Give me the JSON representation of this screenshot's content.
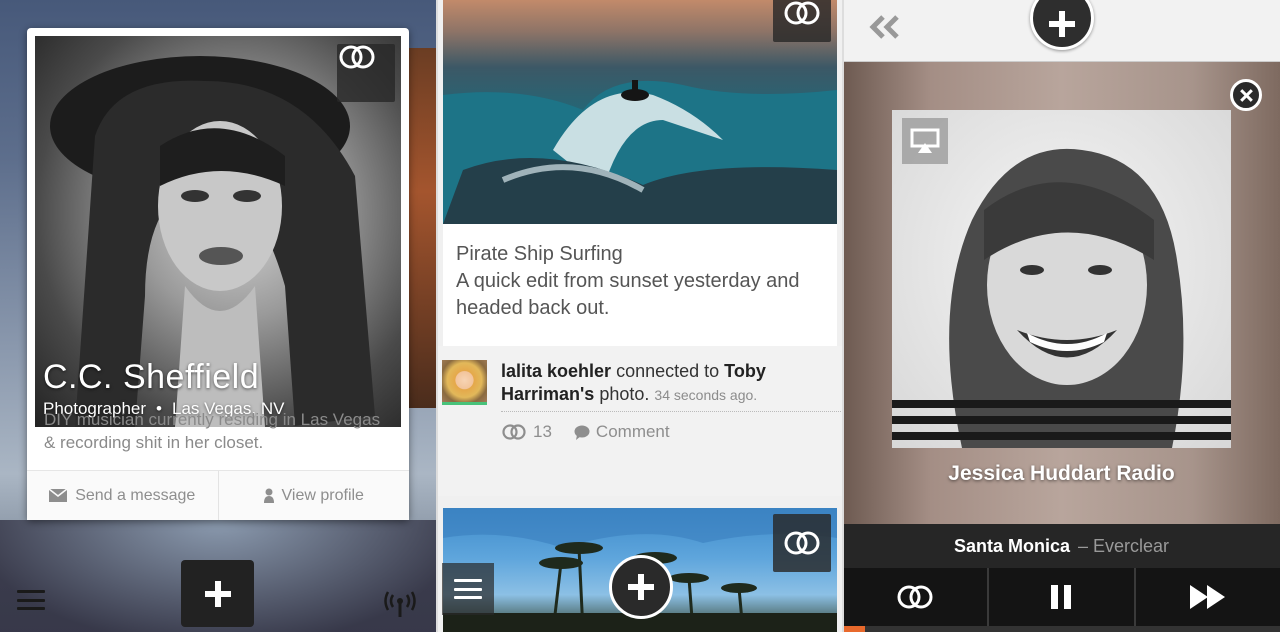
{
  "panel_profile": {
    "name": "C.C. Sheffield",
    "role": "Photographer",
    "separator": "•",
    "location": "Las Vegas, NV",
    "bio": "DIY musician currently residing in Las Vegas & recording shit in her closet.",
    "send_message_label": "Send a message",
    "view_profile_label": "View profile"
  },
  "panel_feed": {
    "post_title": "Pirate Ship Surfing",
    "post_body": "A quick edit from sunset yesterday and headed back out.",
    "activity_user": "lalita koehler",
    "activity_action": "connected to",
    "activity_target": "Toby Harriman's",
    "activity_object": "photo.",
    "activity_time": "34 seconds ago.",
    "connections_count": "13",
    "comment_label": "Comment"
  },
  "panel_player": {
    "station_name": "Jessica Huddart Radio",
    "track_title": "Santa Monica",
    "track_artist": "– Everclear",
    "progress_fraction": 0.05,
    "accent_color": "#e8692c"
  }
}
